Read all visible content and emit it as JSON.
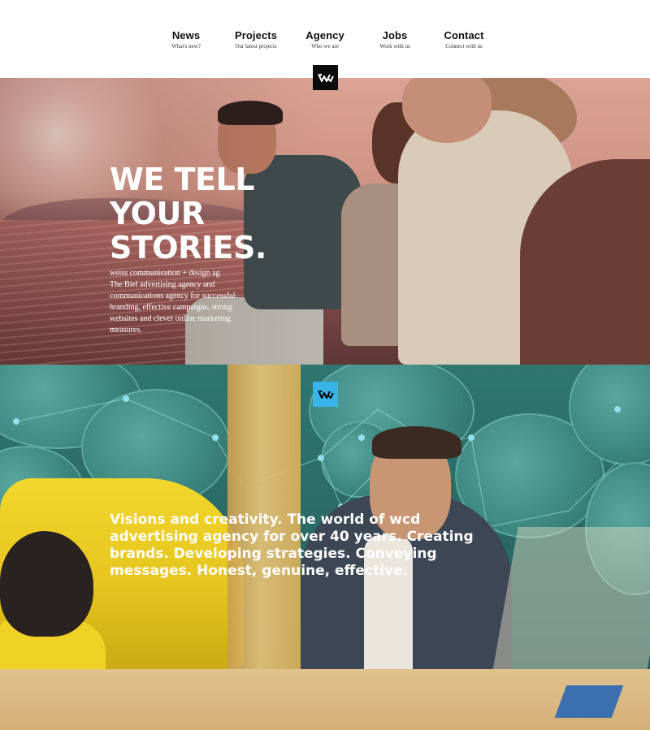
{
  "nav": {
    "items": [
      {
        "title": "News",
        "subtitle": "What's new?"
      },
      {
        "title": "Projects",
        "subtitle": "Our latest projects"
      },
      {
        "title": "Agency",
        "subtitle": "Who we are"
      },
      {
        "title": "Jobs",
        "subtitle": "Work with us"
      },
      {
        "title": "Contact",
        "subtitle": "Connect with us"
      }
    ]
  },
  "logo": {
    "icon": "wcd-logo-icon",
    "dark_bg": "#0b0b0b",
    "blue_bg": "#38b4e8"
  },
  "hero": {
    "headline": [
      "WE TELL",
      "YOUR",
      "STORIES."
    ],
    "body": [
      "weiss communication + design ag",
      "The Biel advertising agency and",
      "communications agency for successful",
      "branding, effective campaigns, strong",
      "websites and clever online marketing",
      "measures."
    ]
  },
  "section2": {
    "text": [
      "Visions and creativity. The world of wcd",
      "advertising agency for over 40 years. Creating",
      "brands. Developing strategies. Conveying",
      "messages. Honest, genuine, effective."
    ]
  }
}
